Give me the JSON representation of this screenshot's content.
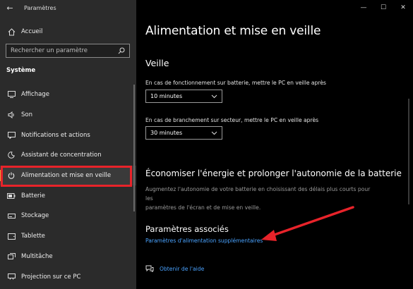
{
  "window": {
    "app_title": "Paramètres",
    "back_glyph": "←",
    "controls": {
      "minimize": "—",
      "maximize": "☐",
      "close": "✕"
    }
  },
  "sidebar": {
    "home_label": "Accueil",
    "search_placeholder": "Rechercher un paramètre",
    "section_title": "Système",
    "items": [
      {
        "label": "Affichage",
        "icon": "monitor-icon"
      },
      {
        "label": "Son",
        "icon": "speaker-icon"
      },
      {
        "label": "Notifications et actions",
        "icon": "notification-icon"
      },
      {
        "label": "Assistant de concentration",
        "icon": "moon-icon"
      },
      {
        "label": "Alimentation et mise en veille",
        "icon": "power-icon",
        "active": true
      },
      {
        "label": "Batterie",
        "icon": "battery-icon"
      },
      {
        "label": "Stockage",
        "icon": "storage-icon"
      },
      {
        "label": "Tablette",
        "icon": "tablet-icon"
      },
      {
        "label": "Multitâche",
        "icon": "multitask-icon"
      },
      {
        "label": "Projection sur ce PC",
        "icon": "projection-icon"
      }
    ]
  },
  "main": {
    "page_title": "Alimentation et mise en veille",
    "sleep": {
      "heading": "Veille",
      "battery_label": "En cas de fonctionnement sur batterie, mettre le PC en veille après",
      "battery_value": "10 minutes",
      "plugged_label": "En cas de branchement sur secteur, mettre le PC en veille après",
      "plugged_value": "30 minutes"
    },
    "save_energy": {
      "heading": "Économiser l'énergie et prolonger l'autonomie de la batterie",
      "description_line1": "Augmentez l'autonomie de votre batterie en choisissant des délais plus courts pour les",
      "description_line2": "paramètres de l'écran et de mise en veille."
    },
    "related": {
      "heading": "Paramètres associés",
      "link": "Paramètres d'alimentation supplémentaires"
    },
    "help_link": "Obtenir de l'aide"
  },
  "colors": {
    "accent": "#e7a23b",
    "highlight": "#e8232a",
    "link": "#4aa3ff"
  }
}
